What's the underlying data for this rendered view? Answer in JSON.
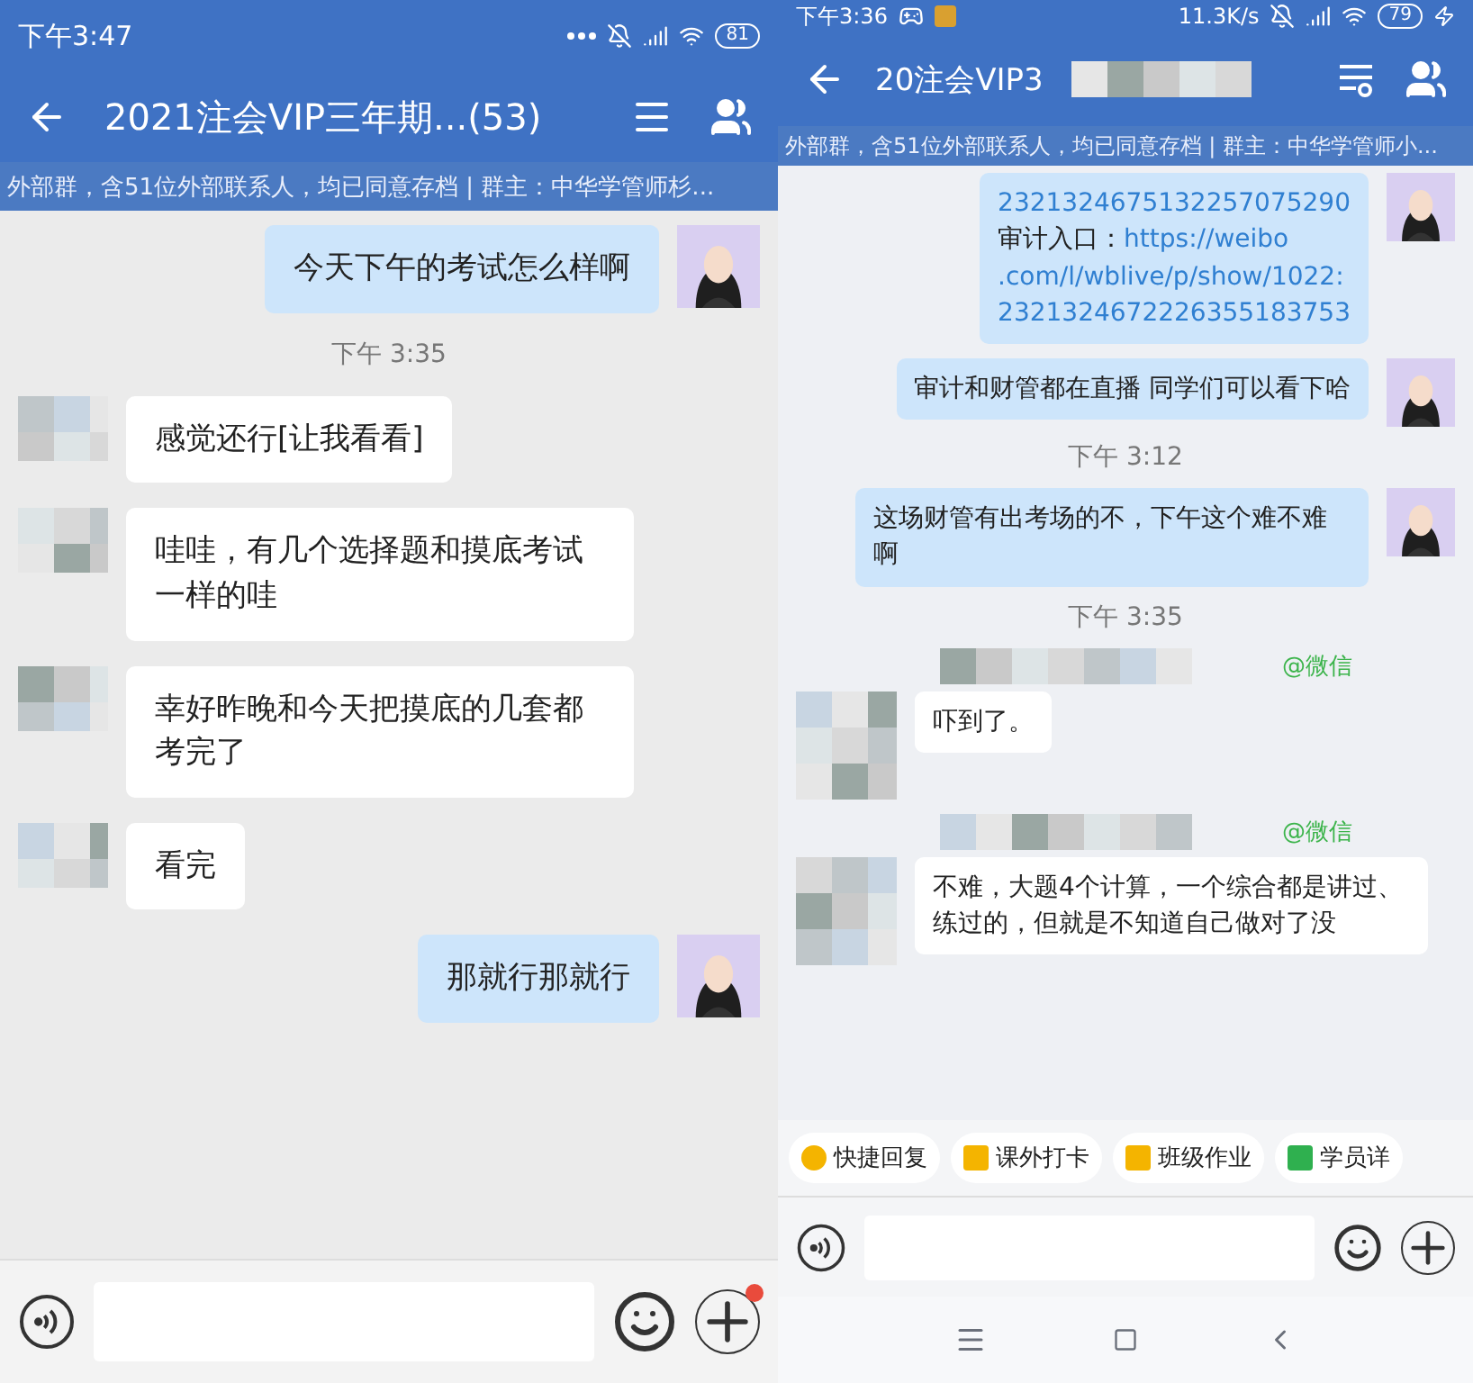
{
  "panels": [
    {
      "status": {
        "time": "下午3:47",
        "battery": "81"
      },
      "header": {
        "title": "2021注会VIP三年期...(53)"
      },
      "notice": "外部群，含51位外部联系人，均已同意存档 | 群主：中华学管师杉...",
      "messages": [
        {
          "kind": "outgoing",
          "text": "今天下午的考试怎么样啊"
        },
        {
          "kind": "time",
          "text": "下午 3:35"
        },
        {
          "kind": "incoming",
          "text": "感觉还行[让我看看]"
        },
        {
          "kind": "incoming",
          "text": "哇哇，有几个选择题和摸底考试一样的哇"
        },
        {
          "kind": "incoming",
          "text": "幸好昨晚和今天把摸底的几套都考完了"
        },
        {
          "kind": "incoming",
          "text": "看完"
        },
        {
          "kind": "outgoing",
          "text": "那就行那就行"
        }
      ],
      "input": {
        "plus_badge": true
      }
    },
    {
      "status": {
        "time": "下午3:36",
        "speed": "11.3K/s",
        "battery": "79"
      },
      "header": {
        "title": "20注会VIP3"
      },
      "notice": "外部群，含51位外部联系人，均已同意存档 | 群主：中华学管师小...",
      "messages": [
        {
          "kind": "outgoing",
          "lines": [
            [
              {
                "kind": "link",
                "text": "2321324675132257075290"
              }
            ],
            [
              {
                "kind": "text",
                "text": "审计入口："
              },
              {
                "kind": "link",
                "text": "https://weibo"
              }
            ],
            [
              {
                "kind": "link",
                "text": ".com/l/wblive/p/show/1022:"
              }
            ],
            [
              {
                "kind": "link",
                "text": "2321324672226355183753"
              }
            ]
          ]
        },
        {
          "kind": "outgoing",
          "text": "审计和财管都在直播 同学们可以看下哈"
        },
        {
          "kind": "time",
          "text": "下午 3:12"
        },
        {
          "kind": "outgoing",
          "text": "这场财管有出考场的不，下午这个难不难啊"
        },
        {
          "kind": "time",
          "text": "下午 3:35"
        },
        {
          "kind": "incoming",
          "source": "@微信",
          "text": "吓到了。"
        },
        {
          "kind": "incoming",
          "source": "@微信",
          "text": "不难，大题4个计算，一个综合都是讲过、练过的，但就是不知道自己做对了没"
        }
      ],
      "quick_actions": [
        {
          "text": "快捷回复"
        },
        {
          "text": "课外打卡"
        },
        {
          "text": "班级作业"
        },
        {
          "text": "学员详"
        }
      ],
      "input": {
        "plus_badge": false
      }
    }
  ]
}
